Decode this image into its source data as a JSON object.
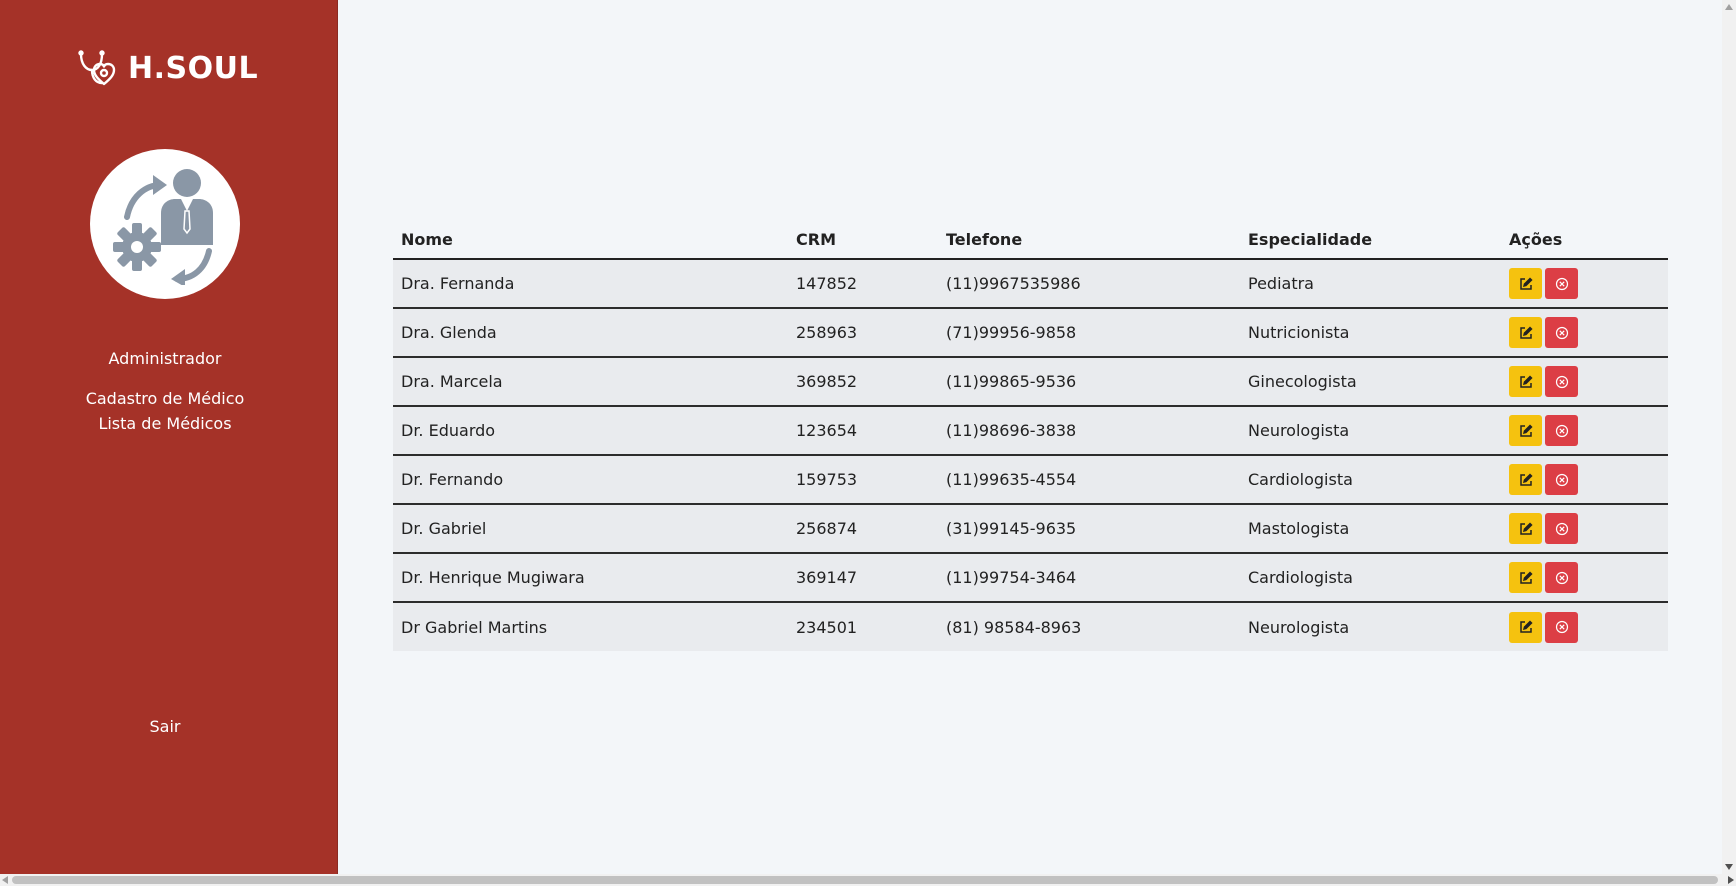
{
  "brand": {
    "name": "H.SOUL"
  },
  "sidebar": {
    "profile_label": "Administrador",
    "links": [
      {
        "label": "Cadastro de Médico"
      },
      {
        "label": "Lista de Médicos"
      }
    ],
    "logout_label": "Sair"
  },
  "table": {
    "headers": [
      "Nome",
      "CRM",
      "Telefone",
      "Especialidade",
      "Ações"
    ],
    "rows": [
      {
        "nome": "Dra. Fernanda",
        "crm": "147852",
        "telefone": "(11)9967535986",
        "especialidade": "Pediatra"
      },
      {
        "nome": "Dra. Glenda",
        "crm": "258963",
        "telefone": "(71)99956-9858",
        "especialidade": "Nutricionista"
      },
      {
        "nome": "Dra. Marcela",
        "crm": "369852",
        "telefone": "(11)99865-9536",
        "especialidade": "Ginecologista"
      },
      {
        "nome": "Dr. Eduardo",
        "crm": "123654",
        "telefone": "(11)98696-3838",
        "especialidade": "Neurologista"
      },
      {
        "nome": "Dr. Fernando",
        "crm": "159753",
        "telefone": "(11)99635-4554",
        "especialidade": "Cardiologista"
      },
      {
        "nome": "Dr. Gabriel",
        "crm": "256874",
        "telefone": "(31)99145-9635",
        "especialidade": "Mastologista"
      },
      {
        "nome": "Dr. Henrique Mugiwara",
        "crm": "369147",
        "telefone": "(11)99754-3464",
        "especialidade": "Cardiologista"
      },
      {
        "nome": "Dr Gabriel Martins",
        "crm": "234501",
        "telefone": "(81) 98584-8963",
        "especialidade": "Neurologista"
      }
    ]
  },
  "icons": {
    "logo": "stethoscope-heart-icon",
    "avatar": "admin-user-gear-icon",
    "edit": "edit-icon",
    "delete": "close-circle-icon"
  },
  "colors": {
    "sidebar": "#a53228",
    "background": "#f3f6f9",
    "row": "#e9ebee",
    "edit_button": "#f5c20f",
    "delete_button": "#dc3e45",
    "avatar_icon": "#8a97a6"
  }
}
